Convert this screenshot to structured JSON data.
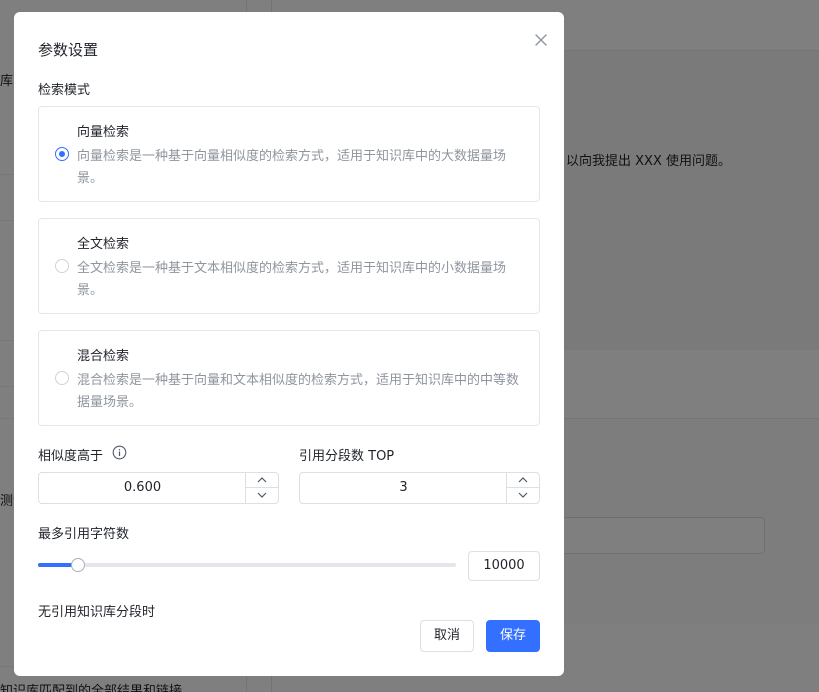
{
  "background": {
    "left_fragment_1": "库",
    "left_fragment_2": "测试",
    "left_fragment_3": "知识库匹配到的全部结果和链接",
    "right_message": "以向我提出 XXX 使用问题。"
  },
  "dialog": {
    "title": "参数设置",
    "retrieval_mode_label": "检索模式",
    "modes": [
      {
        "title": "向量检索",
        "desc": "向量检索是一种基于向量相似度的检索方式，适用于知识库中的大数据量场景。",
        "selected": true
      },
      {
        "title": "全文检索",
        "desc": "全文检索是一种基于文本相似度的检索方式，适用于知识库中的小数据量场景。",
        "selected": false
      },
      {
        "title": "混合检索",
        "desc": "混合检索是一种基于向量和文本相似度的检索方式，适用于知识库中的中等数据量场景。",
        "selected": false
      }
    ],
    "similarity_label": "相似度高于",
    "similarity_value": "0.600",
    "top_label": "引用分段数 TOP",
    "top_value": "3",
    "max_chars_label": "最多引用字符数",
    "max_chars_value": "10000",
    "max_chars_fraction": 0.095,
    "no_reference_label": "无引用知识库分段时",
    "cancel_label": "取消",
    "save_label": "保存"
  },
  "colors": {
    "primary": "#3370ff",
    "text": "#1f2329",
    "muted": "#8f959e",
    "border": "#dcdfe6"
  }
}
